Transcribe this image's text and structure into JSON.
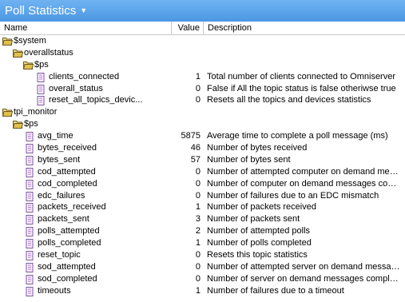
{
  "window": {
    "title": "Poll Statistics"
  },
  "columns": {
    "name": "Name",
    "value": "Value",
    "description": "Description"
  },
  "rows": [
    {
      "type": "folder",
      "level": 0,
      "name": "$system",
      "value": "",
      "description": ""
    },
    {
      "type": "folder",
      "level": 1,
      "name": "overallstatus",
      "value": "",
      "description": ""
    },
    {
      "type": "folder",
      "level": 2,
      "name": "$ps",
      "value": "",
      "description": ""
    },
    {
      "type": "item",
      "level": 3,
      "name": "clients_connected",
      "value": "1",
      "description": "Total number of clients connected to Omniserver"
    },
    {
      "type": "item",
      "level": 3,
      "name": "overall_status",
      "value": "0",
      "description": "False if All the topic status is false otheriwse true"
    },
    {
      "type": "item",
      "level": 3,
      "name": "reset_all_topics_devic...",
      "value": "0",
      "description": "Resets all the topics and devices statistics"
    },
    {
      "type": "folder",
      "level": 0,
      "name": "tpi_monitor",
      "value": "",
      "description": ""
    },
    {
      "type": "folder",
      "level": 1,
      "name": "$ps",
      "value": "",
      "description": ""
    },
    {
      "type": "item",
      "level": 2,
      "name": "avg_time",
      "value": "5875",
      "description": "Average time to complete a poll message (ms)"
    },
    {
      "type": "item",
      "level": 2,
      "name": "bytes_received",
      "value": "46",
      "description": "Number of bytes received"
    },
    {
      "type": "item",
      "level": 2,
      "name": "bytes_sent",
      "value": "57",
      "description": "Number of bytes sent"
    },
    {
      "type": "item",
      "level": 2,
      "name": "cod_attempted",
      "value": "0",
      "description": "Number of attempted computer on demand mess..."
    },
    {
      "type": "item",
      "level": 2,
      "name": "cod_completed",
      "value": "0",
      "description": "Number of computer on demand messages comp..."
    },
    {
      "type": "item",
      "level": 2,
      "name": "edc_failures",
      "value": "0",
      "description": "Number of failures due to an EDC mismatch"
    },
    {
      "type": "item",
      "level": 2,
      "name": "packets_received",
      "value": "1",
      "description": "Number of packets received"
    },
    {
      "type": "item",
      "level": 2,
      "name": "packets_sent",
      "value": "3",
      "description": "Number of packets sent"
    },
    {
      "type": "item",
      "level": 2,
      "name": "polls_attempted",
      "value": "2",
      "description": "Number of attempted polls"
    },
    {
      "type": "item",
      "level": 2,
      "name": "polls_completed",
      "value": "1",
      "description": "Number of polls completed"
    },
    {
      "type": "item",
      "level": 2,
      "name": "reset_topic",
      "value": "0",
      "description": "Resets this topic statistics"
    },
    {
      "type": "item",
      "level": 2,
      "name": "sod_attempted",
      "value": "0",
      "description": "Number of attempted server on demand messages"
    },
    {
      "type": "item",
      "level": 2,
      "name": "sod_completed",
      "value": "0",
      "description": "Number of server on demand messages completed"
    },
    {
      "type": "item",
      "level": 2,
      "name": "timeouts",
      "value": "1",
      "description": "Number of failures due to a timeout"
    }
  ],
  "icons": {
    "folder": "open-folder-icon",
    "item": "document-icon",
    "dropdown": "chevron-down-icon"
  },
  "colors": {
    "titlebar": "#5aa3ea",
    "folder": "#e7c95a",
    "document_border": "#7a5a9e"
  }
}
